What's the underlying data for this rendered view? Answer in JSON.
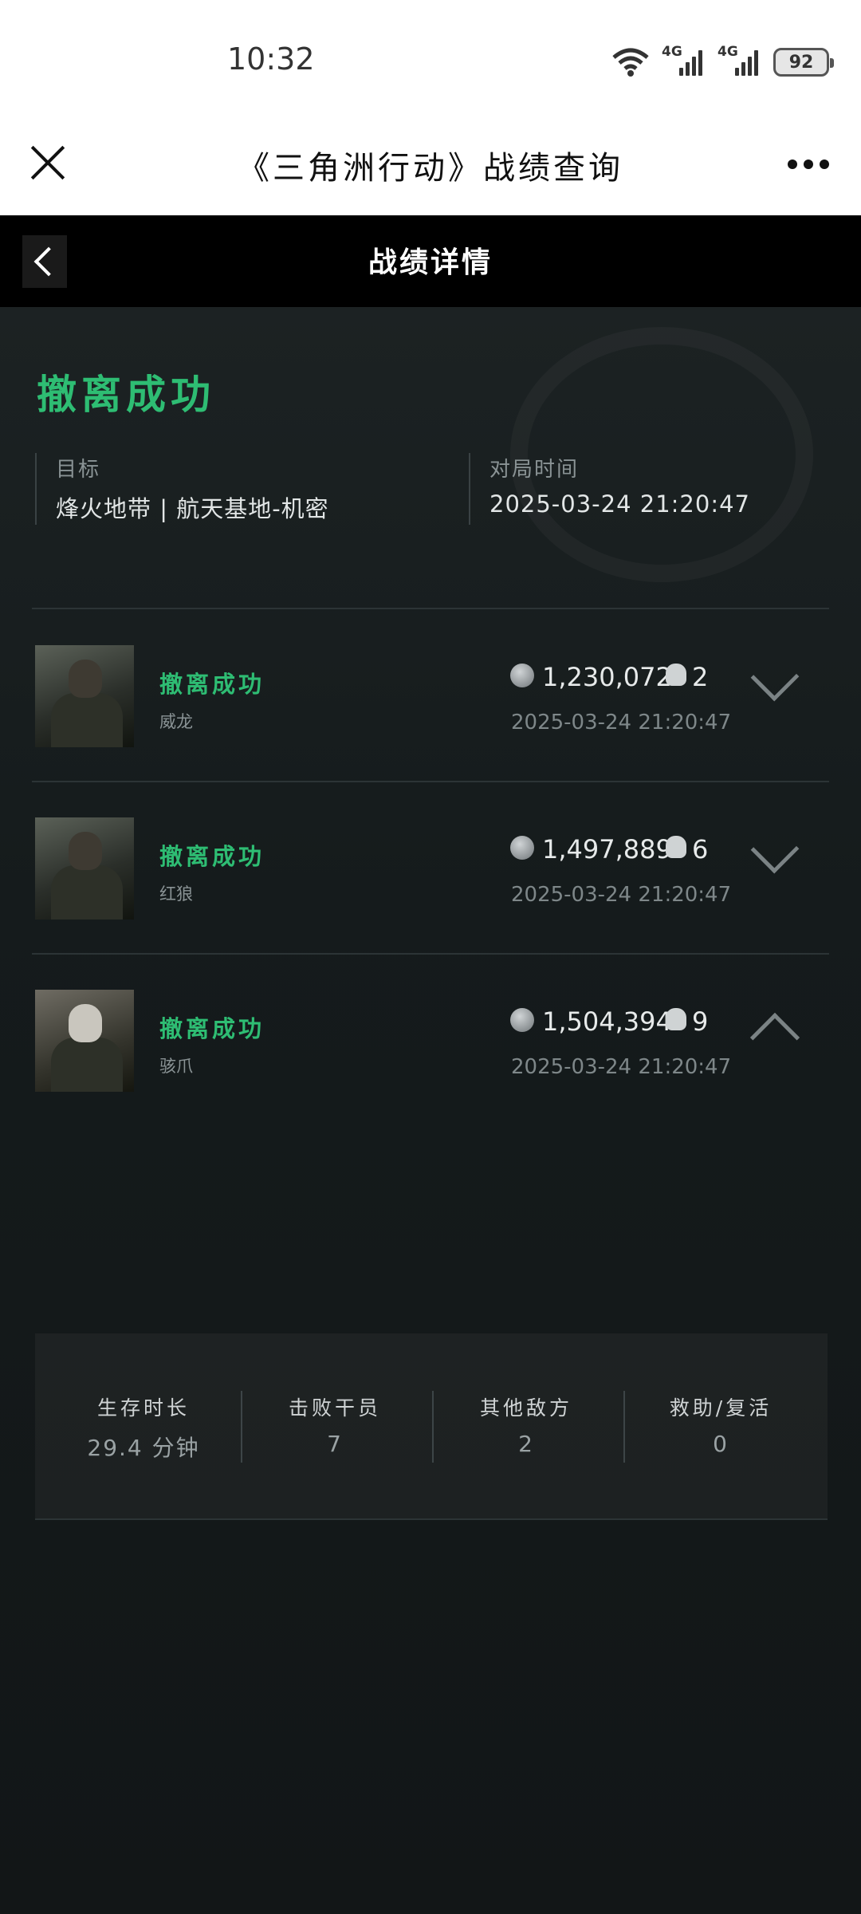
{
  "status_bar": {
    "time": "10:32",
    "signal1_label": "4G",
    "signal2_label": "4G",
    "battery": "92",
    "icons": [
      "wifi-icon",
      "signal-icon",
      "signal-icon",
      "battery-icon"
    ]
  },
  "titlebar": {
    "title": "《三角洲行动》战绩查询",
    "close_icon": "close-icon",
    "more_icon": "more-icon"
  },
  "header": {
    "title": "战绩详情",
    "back_icon": "chevron-left-icon"
  },
  "summary": {
    "result": "撤离成功",
    "target_label": "目标",
    "target_value": "烽火地带 | 航天基地-机密",
    "time_label": "对局时间",
    "time_value": "2025-03-24 21:20:47"
  },
  "matches": [
    {
      "status": "撤离成功",
      "name": "威龙",
      "value": "1,230,072",
      "kills": "2",
      "time": "2025-03-24 21:20:47",
      "expanded": false
    },
    {
      "status": "撤离成功",
      "name": "红狼",
      "value": "1,497,889",
      "kills": "6",
      "time": "2025-03-24 21:20:47",
      "expanded": false
    },
    {
      "status": "撤离成功",
      "name": "骇爪",
      "value": "1,504,394",
      "kills": "9",
      "time": "2025-03-24 21:20:47",
      "expanded": true
    }
  ],
  "details": {
    "survival_label": "生存时长",
    "survival_value": "29.4 分钟",
    "operators_label": "击败干员",
    "operators_value": "7",
    "others_label": "其他敌方",
    "others_value": "2",
    "assist_label": "救助/复活",
    "assist_value": "0"
  },
  "colors": {
    "accent_green": "#2ebd73",
    "background": "#1a2022",
    "header_bg": "#000000"
  }
}
